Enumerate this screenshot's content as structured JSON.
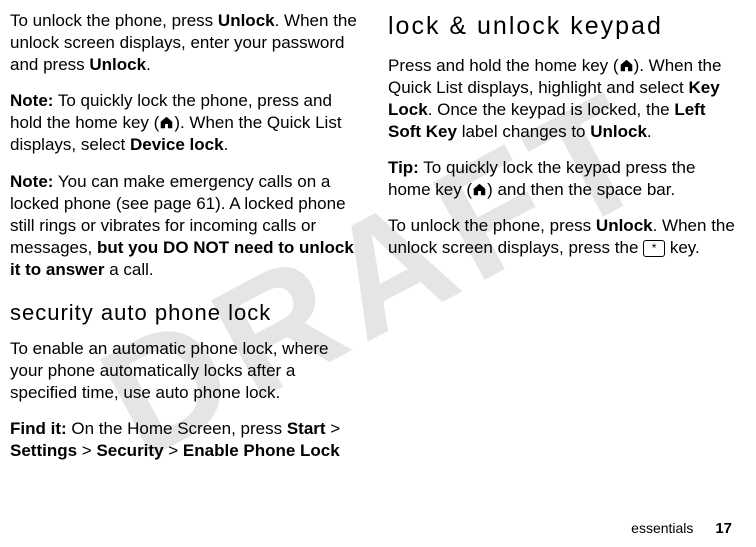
{
  "watermark": "DRAFT",
  "left": {
    "p1_a": "To unlock the phone, press ",
    "p1_unlock1": "Unlock",
    "p1_b": ". When the unlock screen displays, enter your password and press ",
    "p1_unlock2": "Unlock",
    "p1_c": ".",
    "p2_note": "Note:",
    "p2_a": " To quickly lock the phone, press and hold the home key (",
    "p2_b": "). When the Quick List displays, select ",
    "p2_devlock": "Device lock",
    "p2_c": ".",
    "p3_note": "Note:",
    "p3_a": " You can make emergency calls on a locked phone (see page 61). A locked phone still rings or vibrates for incoming calls or messages, ",
    "p3_bold": "but you DO NOT need to unlock it to answer",
    "p3_b": " a call.",
    "h1": "security auto phone lock",
    "p4": "To enable an automatic phone lock, where your phone automatically locks after a specified time, use auto phone lock.",
    "p5_find": "Find it:",
    "p5_a": " On the Home Screen, press ",
    "p5_start": "Start",
    "p5_gt1": " > ",
    "p5_settings": "Settings",
    "p5_gt2": " > ",
    "p5_security": "Security",
    "p5_gt3": " > ",
    "p5_enable": "Enable Phone Lock"
  },
  "right": {
    "h1": "lock & unlock keypad",
    "p1_a": "Press and hold the home key (",
    "p1_b": "). When the Quick List displays, highlight and select ",
    "p1_keylock": "Key Lock",
    "p1_c": ". Once the keypad is locked, the ",
    "p1_lsk": "Left Soft Key",
    "p1_d": " label changes to ",
    "p1_unlock": "Unlock",
    "p1_e": ".",
    "p2_tip": "Tip:",
    "p2_a": " To quickly lock the keypad press the home key (",
    "p2_b": ") and then the space bar.",
    "p3_a": "To unlock the phone, press ",
    "p3_unlock": "Unlock",
    "p3_b": ". When the unlock screen displays, press the ",
    "p3_keylabel": "*",
    "p3_c": " key."
  },
  "footer": {
    "section": "essentials",
    "page": "17"
  }
}
